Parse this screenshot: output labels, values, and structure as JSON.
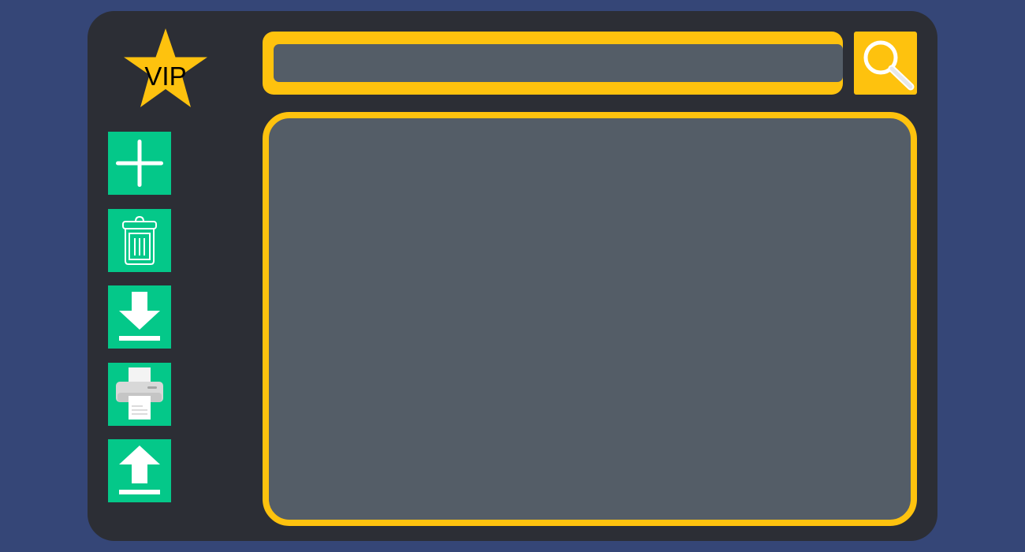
{
  "window": {
    "badge": {
      "label": "VIP",
      "icon": "star-icon",
      "color": "#fec20e"
    },
    "toolbar": {
      "accent_color": "#04c889",
      "items": [
        {
          "name": "add",
          "icon": "plus-icon"
        },
        {
          "name": "delete",
          "icon": "trash-icon"
        },
        {
          "name": "download",
          "icon": "download-icon"
        },
        {
          "name": "print",
          "icon": "printer-icon"
        },
        {
          "name": "upload",
          "icon": "upload-icon"
        }
      ]
    },
    "search": {
      "value": "",
      "placeholder": "",
      "button_icon": "magnifier-icon"
    },
    "content": {
      "text": ""
    },
    "colors": {
      "background": "#354677",
      "window": "#2c2e35",
      "panel": "#545d67",
      "highlight": "#fec20e",
      "action": "#04c889"
    }
  }
}
